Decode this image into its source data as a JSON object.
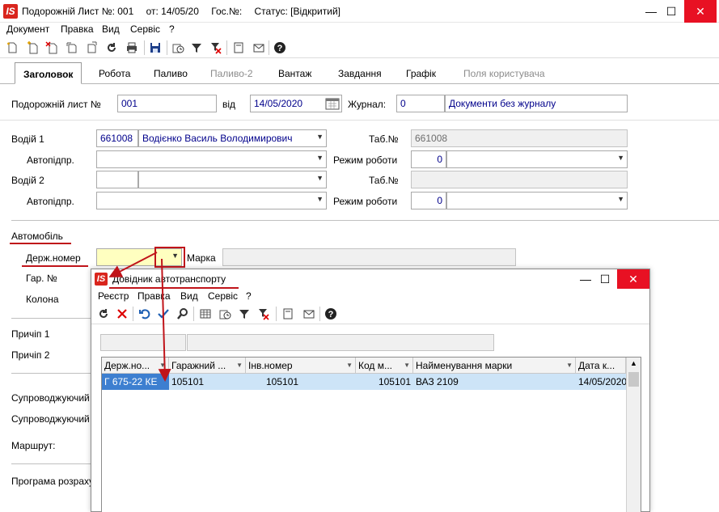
{
  "window": {
    "logo": "IS",
    "title_parts": [
      "Подорожній Лист №: 001",
      "от: 14/05/20",
      "Гос.№:",
      "Статус: [Відкритий]"
    ],
    "minimize": "—",
    "maximize": "☐",
    "close": "✕"
  },
  "menu": [
    "Документ",
    "Правка",
    "Вид",
    "Сервіс",
    "?"
  ],
  "toolbar_icons": [
    "new-doc-icon",
    "new-copy-icon",
    "delete-doc-icon",
    "import-icon",
    "export-icon",
    "refresh-icon",
    "print-icon",
    "save-icon",
    "schedule-icon",
    "filter-icon",
    "clear-filter-icon",
    "notes-icon",
    "mail-icon",
    "help-icon"
  ],
  "tabs": [
    {
      "label": "Заголовок",
      "state": "active"
    },
    {
      "label": "Робота",
      "state": "normal"
    },
    {
      "label": "Паливо",
      "state": "normal"
    },
    {
      "label": "Паливо-2",
      "state": "disabled"
    },
    {
      "label": "Вантаж",
      "state": "normal"
    },
    {
      "label": "Завдання",
      "state": "normal"
    },
    {
      "label": "Графік",
      "state": "normal"
    },
    {
      "label": "Поля користувача",
      "state": "disabled"
    }
  ],
  "form": {
    "waybill_label": "Подорожній лист №",
    "waybill_no": "001",
    "date_label": "від",
    "date": "14/05/2020",
    "journal_label": "Журнал:",
    "journal_no": "0",
    "journal_name": "Документи без журналу",
    "driver1_label": "Водій 1",
    "driver1_code": "661008",
    "driver1_name": "Водієнко Василь Володимирович",
    "tab_label": "Таб.№",
    "driver1_tab": "661008",
    "company_label": "Автопідпр.",
    "mode_label": "Режим роботи",
    "mode1_value": "0",
    "driver2_label": "Водій 2",
    "tab2_label": "Таб.№",
    "company2_label": "Автопідпр.",
    "mode2_label": "Режим роботи",
    "mode2_value": "0",
    "car_section": "Автомобіль",
    "plate_label": "Держ.номер",
    "brand_label": "Марка",
    "garage_label": "Гар. №",
    "column_label": "Колона",
    "trailer1_label": "Причіп 1",
    "trailer2_label": "Причіп 2",
    "escort1_label": "Супроводжуючий",
    "escort2_label": "Супроводжуючий",
    "route_label": "Маршрут:",
    "program_label": "Програма розрахунку"
  },
  "dialog": {
    "logo": "IS",
    "title": "Довідник автотранспорту",
    "minimize": "—",
    "maximize": "☐",
    "close": "✕",
    "menu": [
      "Реєстр",
      "Правка",
      "Вид",
      "Сервіс",
      "?"
    ],
    "toolbar_icons": [
      "refresh-icon",
      "delete-icon",
      "undo-icon",
      "check-icon",
      "search-icon",
      "table-icon",
      "schedule-icon",
      "filter-icon",
      "clear-filter-icon",
      "notes-icon",
      "mail-icon",
      "help-icon"
    ],
    "columns": [
      "Держ.но...",
      "Гаражний ...",
      "Інв.номер",
      "Код м...",
      "Найменування марки",
      "Дата к..."
    ],
    "rows": [
      [
        "Г 675-22 КЕ",
        "105101",
        "105101",
        "105101",
        "ВАЗ 2109",
        "14/05/2020"
      ]
    ]
  },
  "colors": {
    "accent_red": "#c0141a",
    "selection": "#3d7fd0",
    "row_highlight": "#cde4f7",
    "field_yellow": "#ffffc0"
  }
}
